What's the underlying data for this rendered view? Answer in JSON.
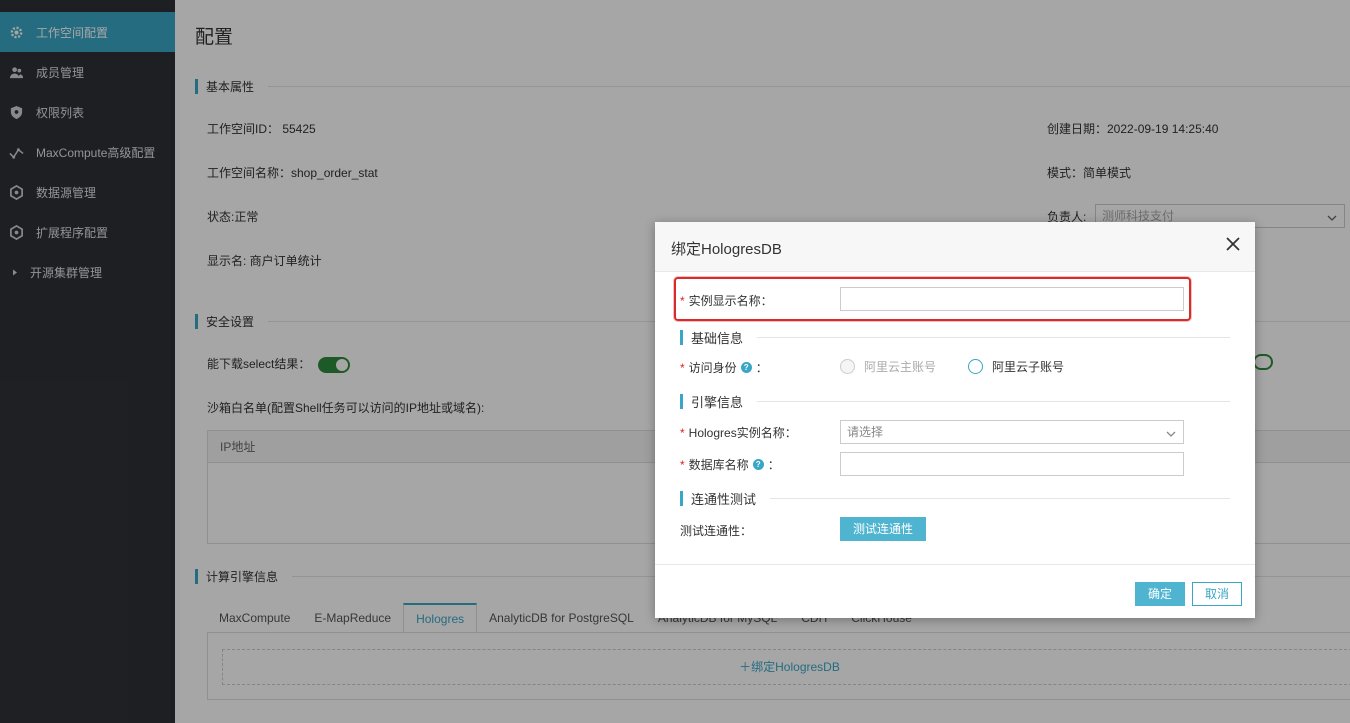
{
  "sidebar": {
    "items": [
      {
        "label": "工作空间配置",
        "icon": "gear-icon",
        "active": true
      },
      {
        "label": "成员管理",
        "icon": "users-icon"
      },
      {
        "label": "权限列表",
        "icon": "shield-icon"
      },
      {
        "label": "MaxCompute高级配置",
        "icon": "graph-icon"
      },
      {
        "label": "数据源管理",
        "icon": "hexagon-icon"
      },
      {
        "label": "扩展程序配置",
        "icon": "hexagon-icon"
      },
      {
        "label": "开源集群管理",
        "icon": "caret-right-icon"
      }
    ]
  },
  "main": {
    "title": "配置",
    "basic": {
      "heading": "基本属性",
      "workspace_id": "工作空间ID：  55425",
      "workspace_name": "工作空间名称：shop_order_stat",
      "status": "状态:正常",
      "display_name": "显示名:   商户订单统计",
      "created": "创建日期：2022-09-19 14:25:40",
      "mode": "模式：简单模式",
      "owner_label": "负责人:",
      "owner_value": "测师科技支付"
    },
    "security": {
      "heading": "安全设置",
      "download_label": "能下载select结果：",
      "sandbox_label": "沙箱白名单(配置Shell任务可以访问的IP地址或域名):",
      "ip_header": "IP地址"
    },
    "engine": {
      "heading": "计算引擎信息",
      "tabs": [
        "MaxCompute",
        "E-MapReduce",
        "Hologres",
        "AnalyticDB for PostgreSQL",
        "AnalyticDB for MySQL",
        "CDH",
        "ClickHouse"
      ],
      "active_tab": "Hologres",
      "bind_link": "＋绑定HologresDB"
    }
  },
  "modal": {
    "title": "绑定HologresDB",
    "instance_display_label": "实例显示名称：",
    "section_basic": "基础信息",
    "identity_label": "访问身份",
    "identity_suffix": "：",
    "identity_option1": "阿里云主账号",
    "identity_option2": "阿里云子账号",
    "section_engine": "引擎信息",
    "hologres_instance_label": "Hologres实例名称：",
    "hologres_instance_placeholder": "请选择",
    "database_label": "数据库名称",
    "database_suffix": "：",
    "section_conn": "连通性测试",
    "test_label": "测试连通性：",
    "test_button": "测试连通性",
    "ok_button": "确定",
    "cancel_button": "取消",
    "help_glyph": "?",
    "required_mark": "*"
  }
}
